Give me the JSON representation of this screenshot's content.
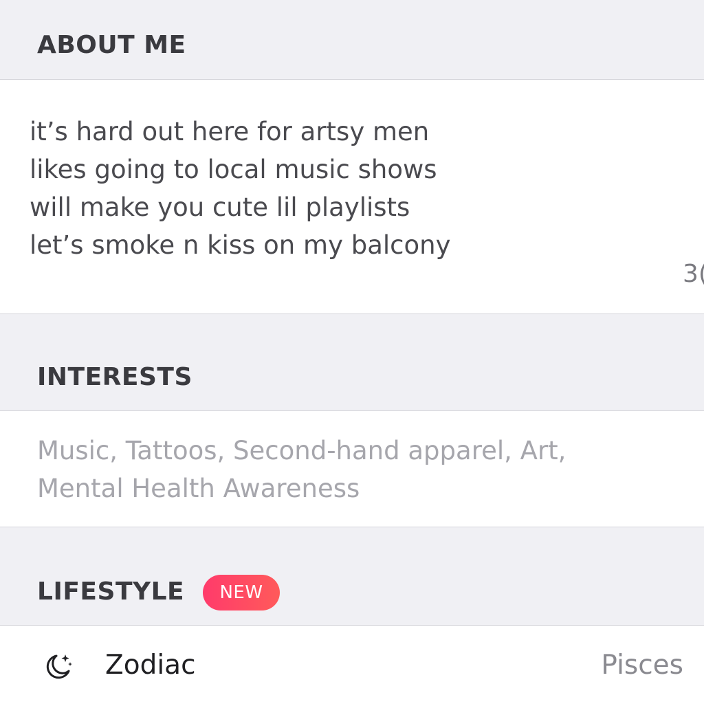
{
  "about_me": {
    "title": "ABOUT ME",
    "bio": "it’s hard out here for artsy men\nlikes going to local music shows\nwill make you cute lil playlists\nlet’s smoke n kiss on my balcony",
    "char_count": "3("
  },
  "interests": {
    "title": "INTERESTS",
    "text": "Music, Tattoos, Second-hand apparel, Art, Mental Health Awareness"
  },
  "lifestyle": {
    "title": "LIFESTYLE",
    "badge": "NEW",
    "badge_color": "#ff4466",
    "items": [
      {
        "icon": "moon-stars-icon",
        "label": "Zodiac",
        "value": "Pisces"
      }
    ]
  }
}
